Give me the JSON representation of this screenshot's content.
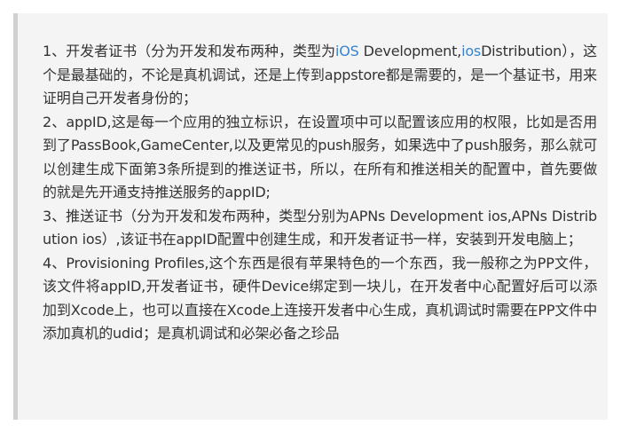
{
  "blockquote": {
    "item1": {
      "prefix": "1、开发者证书（分为开发和发布两种，类型为",
      "link1": "iOS",
      "mid": " Development,",
      "link2": "ios",
      "rest": "Distribution），这个是最基础的，不论是真机调试，还是上传到appstore都是需要的，是一个基证书，用来证明自己开发者身份的；"
    },
    "item2": "2、appID,这是每一个应用的独立标识，在设置项中可以配置该应用的权限，比如是否用到了PassBook,GameCenter,以及更常见的push服务，如果选中了push服务，那么就可以创建生成下面第3条所提到的推送证书，所以，在所有和推送相关的配置中，首先要做的就是先开通支持推送服务的appID;",
    "item3": "3、推送证书（分为开发和发布两种，类型分别为APNs Development ios,APNs Distribution ios）,该证书在appID配置中创建生成，和开发者证书一样，安装到开发电脑上；",
    "item4": "4、Provisioning Profiles,这个东西是很有苹果特色的一个东西，我一般称之为PP文件，该文件将appID,开发者证书，硬件Device绑定到一块儿，在开发者中心配置好后可以添加到Xcode上，也可以直接在Xcode上连接开发者中心生成，真机调试时需要在PP文件中添加真机的udid；是真机调试和必架必备之珍品"
  }
}
